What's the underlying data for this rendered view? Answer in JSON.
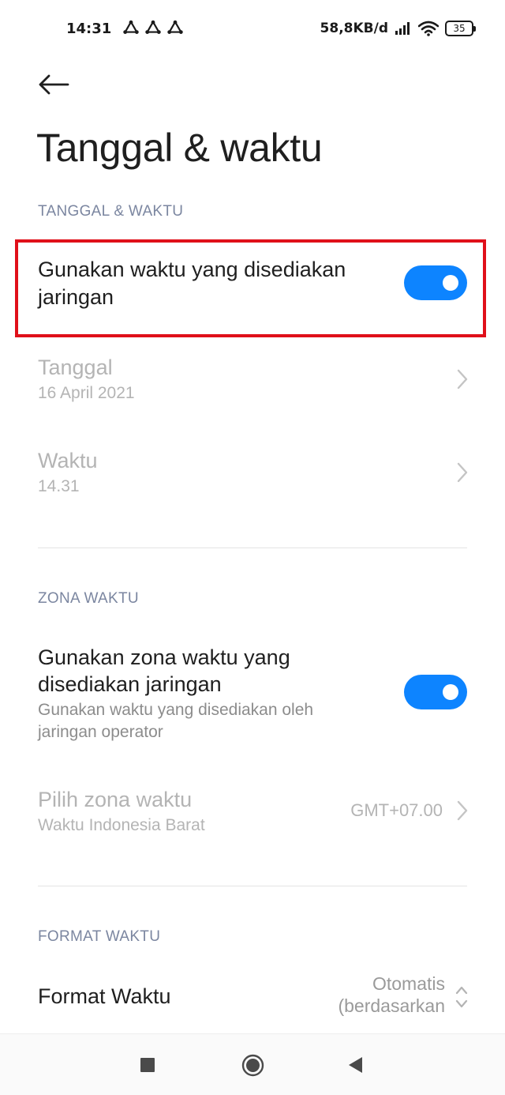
{
  "status_bar": {
    "time": "14:31",
    "network_speed": "58,8KB/d",
    "battery_level": "35",
    "icons": [
      "sync-icon",
      "sync-icon",
      "sync-icon",
      "signal-icon",
      "wifi-icon",
      "battery-icon"
    ]
  },
  "header": {
    "back_icon": "arrow-left-icon",
    "title": "Tanggal & waktu"
  },
  "sections": {
    "date_time": {
      "header": "TANGGAL & WAKTU",
      "network_time": {
        "title_line1": "Gunakan waktu yang disediakan",
        "title_line2": "jaringan",
        "enabled": true
      },
      "date": {
        "title": "Tanggal",
        "value": "16 April 2021"
      },
      "time": {
        "title": "Waktu",
        "value": "14.31"
      }
    },
    "time_zone": {
      "header": "ZONA WAKTU",
      "network_zone": {
        "title_line1": "Gunakan zona waktu yang",
        "title_line2": "disediakan jaringan",
        "subtitle_line1": "Gunakan waktu yang disediakan oleh",
        "subtitle_line2": "jaringan operator",
        "enabled": true
      },
      "select_zone": {
        "title": "Pilih zona waktu",
        "subtitle": "Waktu Indonesia Barat",
        "value": "GMT+07.00"
      }
    },
    "time_format": {
      "header": "FORMAT WAKTU",
      "format": {
        "title": "Format Waktu",
        "value_line1": "Otomatis",
        "value_line2": "(berdasarkan"
      }
    }
  },
  "colors": {
    "accent": "#0d84ff",
    "highlight": "#e0101a",
    "section_header": "#7b86a0",
    "disabled_text": "#b4b4b4"
  },
  "nav_bar": {
    "recent_icon": "square-icon",
    "home_icon": "circle-icon",
    "back_icon": "triangle-back-icon"
  }
}
